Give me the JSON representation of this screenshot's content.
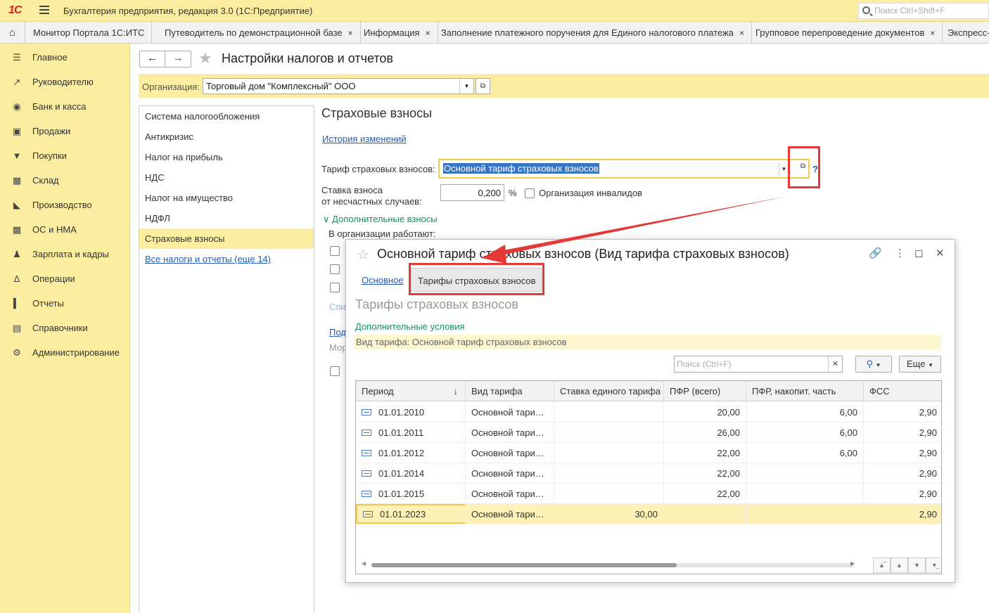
{
  "app": {
    "logo": "1С",
    "title": "Бухгалтерия предприятия, редакция 3.0  (1С:Предприятие)",
    "search_placeholder": "Поиск Ctrl+Shift+F"
  },
  "tabs": [
    {
      "label": "Монитор Портала 1С:ИТС"
    },
    {
      "label": "Путеводитель по демонстрационной базе"
    },
    {
      "label": "Информация"
    },
    {
      "label": "Заполнение платежного поручения для Единого налогового платежа"
    },
    {
      "label": "Групповое перепроведение документов"
    },
    {
      "label": "Экспресс-"
    }
  ],
  "tab_close": "×",
  "sidebar": {
    "items": [
      {
        "label": "Главное",
        "icon": "menu-icon"
      },
      {
        "label": "Руководителю",
        "icon": "chart-icon"
      },
      {
        "label": "Банк и касса",
        "icon": "coin-icon"
      },
      {
        "label": "Продажи",
        "icon": "bag-icon"
      },
      {
        "label": "Покупки",
        "icon": "cart-icon"
      },
      {
        "label": "Склад",
        "icon": "warehouse-icon"
      },
      {
        "label": "Производство",
        "icon": "factory-icon"
      },
      {
        "label": "ОС и НМА",
        "icon": "truck-icon"
      },
      {
        "label": "Зарплата и кадры",
        "icon": "person-icon"
      },
      {
        "label": "Операции",
        "icon": "operations-icon"
      },
      {
        "label": "Отчеты",
        "icon": "bar-chart-icon"
      },
      {
        "label": "Справочники",
        "icon": "book-icon"
      },
      {
        "label": "Администрирование",
        "icon": "gear-icon"
      }
    ]
  },
  "page": {
    "title": "Настройки налогов и отчетов",
    "org_label": "Организация:",
    "org_value": "Торговый дом \"Комплексный\" ООО"
  },
  "nav": {
    "items": [
      {
        "label": "Система налогообложения"
      },
      {
        "label": "Антикризис"
      },
      {
        "label": "Налог на прибыль"
      },
      {
        "label": "НДС"
      },
      {
        "label": "Налог на имущество"
      },
      {
        "label": "НДФЛ"
      },
      {
        "label": "Страховые взносы"
      },
      {
        "label": "Все налоги и отчеты (еще 14)"
      }
    ]
  },
  "content": {
    "section_title": "Страховые взносы",
    "history_link": "История изменений",
    "tariff_label": "Тариф страховых взносов:",
    "tariff_value": "Основной тариф страховых взносов",
    "help": "?",
    "rate_label_1": "Ставка взноса",
    "rate_label_2": "от несчастных случаев:",
    "rate_value": "0,200",
    "pct": "%",
    "invalid_org_label": "Организация инвалидов",
    "extra_toggle": "Дополнительные взносы",
    "org_works": "В организации работают:",
    "partial_1": "Спи",
    "partial_2": "Под",
    "partial_3": "Мор"
  },
  "popup": {
    "title": "Основной тариф страховых взносов (Вид тарифа страховых взносов)",
    "tab_main": "Основное",
    "tab_tariffs": "Тарифы страховых взносов",
    "heading": "Тарифы страховых взносов",
    "additional_conditions": "Дополнительные условия",
    "filter_text": "Вид тарифа: Основной тариф страховых взносов",
    "search_placeholder": "Поиск (Ctrl+F)",
    "more_button": "Еще",
    "columns": [
      "Период",
      "Вид тарифа",
      "Ставка единого тарифа",
      "ПФР (всего)",
      "ПФР, накопит. часть",
      "ФСС"
    ],
    "sort_arrow": "↓",
    "rows": [
      {
        "period": "01.01.2010",
        "kind": "Основной тари…",
        "single": "",
        "pfr": "20,00",
        "pfr_acc": "6,00",
        "fss": "2,90"
      },
      {
        "period": "01.01.2011",
        "kind": "Основной тари…",
        "single": "",
        "pfr": "26,00",
        "pfr_acc": "6,00",
        "fss": "2,90"
      },
      {
        "period": "01.01.2012",
        "kind": "Основной тари…",
        "single": "",
        "pfr": "22,00",
        "pfr_acc": "6,00",
        "fss": "2,90"
      },
      {
        "period": "01.01.2014",
        "kind": "Основной тари…",
        "single": "",
        "pfr": "22,00",
        "pfr_acc": "",
        "fss": "2,90"
      },
      {
        "period": "01.01.2015",
        "kind": "Основной тари…",
        "single": "",
        "pfr": "22,00",
        "pfr_acc": "",
        "fss": "2,90"
      },
      {
        "period": "01.01.2023",
        "kind": "Основной тари…",
        "single": "30,00",
        "pfr": "",
        "pfr_acc": "",
        "fss": "2,90"
      }
    ],
    "selected_row": 5,
    "scroll_position": 0.0
  },
  "colors": {
    "accent_yellow": "#fbeda0",
    "link_blue": "#245cb3",
    "green_text": "#168f6b",
    "annotation_red": "#e53935"
  }
}
